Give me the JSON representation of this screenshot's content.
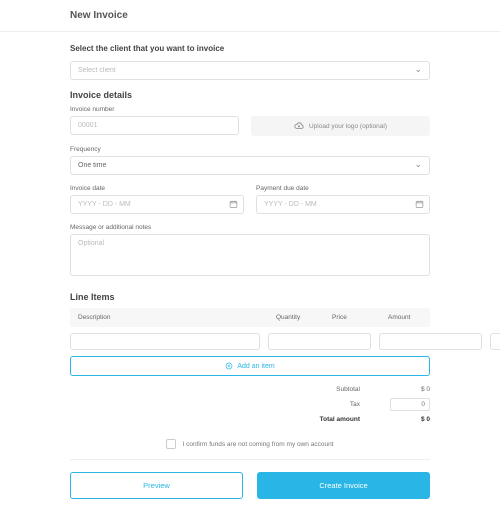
{
  "header": {
    "title": "New Invoice"
  },
  "client": {
    "section_label": "Select the client that you want to invoice",
    "placeholder": "Select client"
  },
  "details": {
    "section_label": "Invoice details",
    "invoice_number_label": "Invoice number",
    "invoice_number_placeholder": "00001",
    "upload_label": "Upload your logo (optional)",
    "frequency_label": "Frequency",
    "frequency_value": "One time",
    "invoice_date_label": "Invoice date",
    "payment_due_label": "Payment due date",
    "date_placeholder": "YYYY - DD - MM",
    "notes_label": "Message or additional notes",
    "notes_placeholder": "Optional"
  },
  "line_items": {
    "section_label": "Line Items",
    "cols": {
      "desc": "Description",
      "qty": "Quantity",
      "price": "Price",
      "amount": "Amount"
    },
    "add_label": "Add an item"
  },
  "totals": {
    "subtotal_label": "Subtotal",
    "subtotal_value": "$ 0",
    "tax_label": "Tax",
    "tax_placeholder": "0",
    "total_label": "Total amount",
    "total_value": "$ 0"
  },
  "confirm": {
    "label": "I confirm funds are not coming from my own account"
  },
  "actions": {
    "preview": "Preview",
    "create": "Create Invoice"
  }
}
